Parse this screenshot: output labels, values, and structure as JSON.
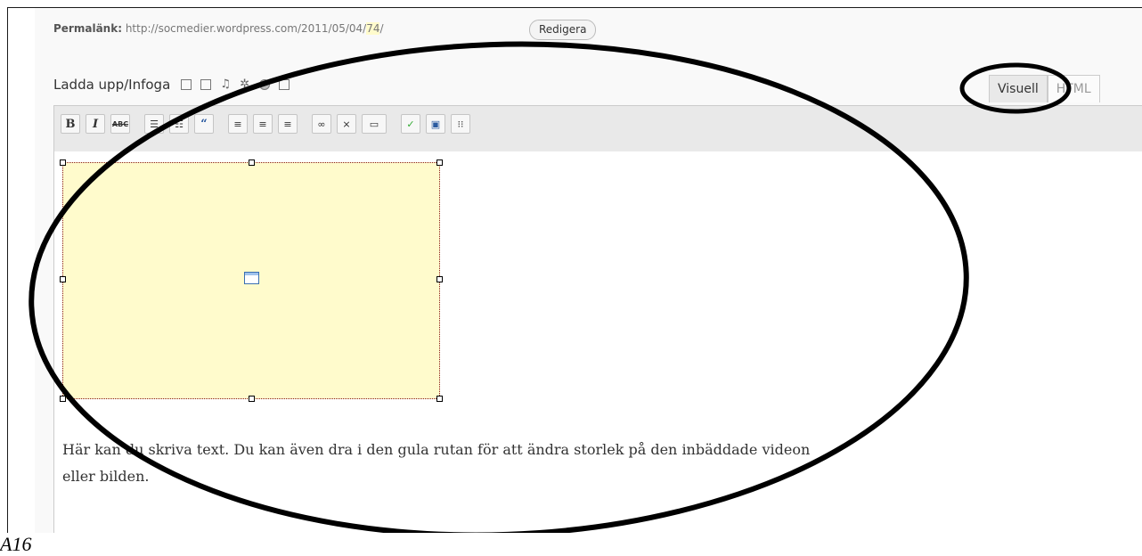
{
  "permalink": {
    "label": "Permalänk:",
    "url_prefix": "http://socmedier.wordpress.com/2011/05/04/",
    "url_highlight": "74",
    "url_suffix": "/",
    "edit_button": "Redigera"
  },
  "media": {
    "label": "Ladda upp/Infoga",
    "icons": [
      "image-icon",
      "video-icon",
      "audio-icon",
      "media-icon",
      "poll-icon",
      "form-icon"
    ]
  },
  "tabs": {
    "visual": "Visuell",
    "html": "HTML"
  },
  "toolbar": {
    "buttons": [
      "bold",
      "italic",
      "strikethrough",
      "unordered-list",
      "ordered-list",
      "blockquote",
      "align-left",
      "align-center",
      "align-right",
      "link",
      "unlink",
      "more",
      "spellcheck",
      "fullscreen",
      "kitchen-sink"
    ]
  },
  "content": {
    "text": "Här kan du skriva text. Du kan även dra i den gula rutan för att ändra storlek på den inbäddade videon eller bilden."
  },
  "caption": "A16",
  "colors": {
    "embed_fill": "#fffbcc",
    "embed_border": "#8a1a1a",
    "toolbar_bg": "#e9e9e9"
  }
}
